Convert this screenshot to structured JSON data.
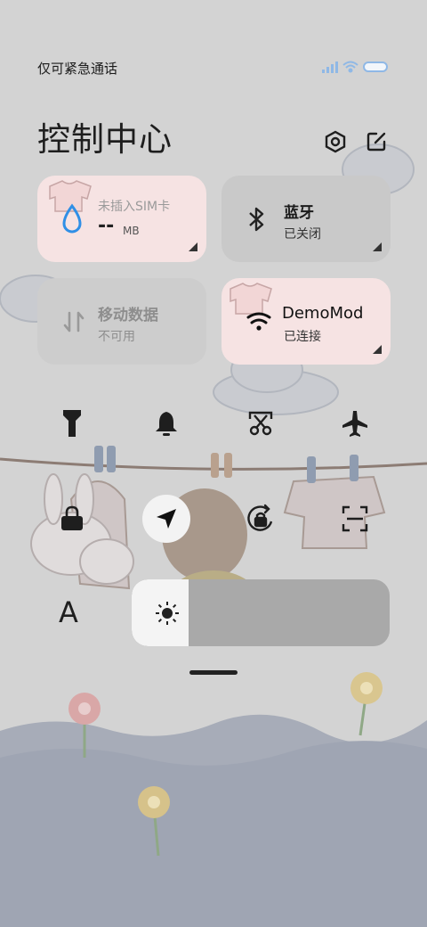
{
  "status_bar": {
    "carrier_text": "仅可紧急通话"
  },
  "header": {
    "title": "控制中心",
    "settings_icon": "settings-hex-icon",
    "edit_icon": "edit-icon"
  },
  "tiles": {
    "data_usage": {
      "title": "未插入SIM卡",
      "value": "--",
      "unit": "MB"
    },
    "bluetooth": {
      "title": "蓝牙",
      "status": "已关闭"
    },
    "mobile_data": {
      "title": "移动数据",
      "status": "不可用"
    },
    "wifi": {
      "title": "DemoMod",
      "status": "已连接"
    }
  },
  "toggles_row1": [
    "flashlight-icon",
    "bell-icon",
    "screenshot-icon",
    "airplane-icon"
  ],
  "toggles_row2": [
    "lock-icon",
    "location-icon",
    "rotation-lock-icon",
    "scan-icon"
  ],
  "brightness": {
    "level": 0.22,
    "font_icon": "A"
  },
  "colors": {
    "pink_tile": "#f6e3e3",
    "grey_tile": "#c9c9c9",
    "accent_blue": "#2f8fe6"
  }
}
